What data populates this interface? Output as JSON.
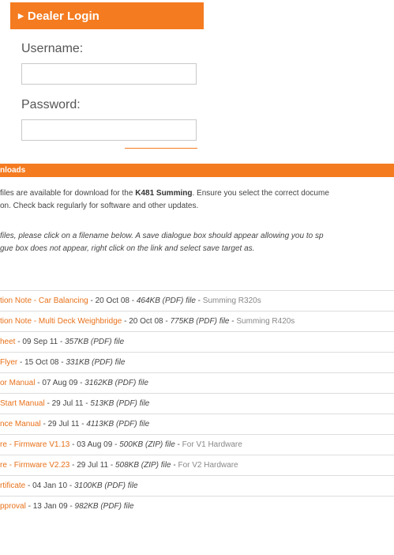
{
  "login": {
    "title": "Dealer Login",
    "username_label": "Username:",
    "password_label": "Password:",
    "username_value": "",
    "password_value": ""
  },
  "downloads": {
    "header": "nloads",
    "intro_pre": "files are available for download for the ",
    "intro_product": "K481 Summing",
    "intro_post": ". Ensure you select the correct docume",
    "intro_line2": "on. Check back regularly for software and other updates.",
    "howto_line1": "files, please click on a filename below. A save dialogue box should appear allowing you to sp",
    "howto_line2": "gue box does not appear, right click on the link and select save target as.",
    "items": [
      {
        "name": "tion Note - Car Balancing",
        "date": "20 Oct 08",
        "size": "464KB (PDF) file",
        "note": "Summing R320s"
      },
      {
        "name": "tion Note - Multi Deck Weighbridge",
        "date": "20 Oct 08",
        "size": "775KB (PDF) file",
        "note": "Summing R420s"
      },
      {
        "name": "heet",
        "date": "09 Sep 11",
        "size": "357KB (PDF) file",
        "note": ""
      },
      {
        "name": "Flyer",
        "date": "15 Oct 08",
        "size": "331KB (PDF) file",
        "note": ""
      },
      {
        "name": "or Manual",
        "date": "07 Aug 09",
        "size": "3162KB (PDF) file",
        "note": ""
      },
      {
        "name": "Start Manual",
        "date": "29 Jul 11",
        "size": "513KB (PDF) file",
        "note": ""
      },
      {
        "name": "nce Manual",
        "date": "29 Jul 11",
        "size": "4113KB (PDF) file",
        "note": ""
      },
      {
        "name": "re - Firmware V1.13",
        "date": "03 Aug 09",
        "size": "500KB (ZIP) file",
        "note": "For V1 Hardware"
      },
      {
        "name": "re - Firmware V2.23",
        "date": "29 Jul 11",
        "size": "508KB (ZIP) file",
        "note": "For V2 Hardware"
      },
      {
        "name": "rtificate",
        "date": "04 Jan 10",
        "size": "3100KB (PDF) file",
        "note": ""
      },
      {
        "name": "pproval",
        "date": "13 Jan 09",
        "size": "982KB (PDF) file",
        "note": ""
      }
    ]
  }
}
